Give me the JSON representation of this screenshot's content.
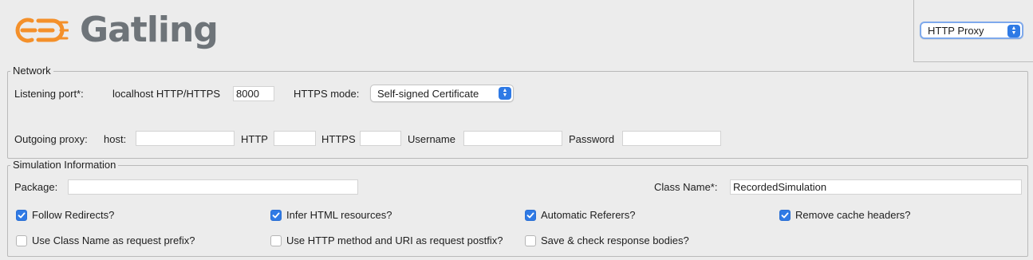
{
  "app": {
    "name": "Gatling"
  },
  "mode": {
    "selected": "HTTP Proxy"
  },
  "network": {
    "legend": "Network",
    "listening_port_label": "Listening port*:",
    "localhost_label": "localhost HTTP/HTTPS",
    "port_value": "8000",
    "https_mode_label": "HTTPS mode:",
    "https_mode_value": "Self-signed Certificate",
    "outgoing_proxy_label": "Outgoing proxy:",
    "host_label": "host:",
    "host_value": "",
    "http_label": "HTTP",
    "http_value": "",
    "https_label": "HTTPS",
    "https_value": "",
    "username_label": "Username",
    "username_value": "",
    "password_label": "Password",
    "password_value": ""
  },
  "simulation": {
    "legend": "Simulation Information",
    "package_label": "Package:",
    "package_value": "",
    "class_name_label": "Class Name*:",
    "class_name_value": "RecordedSimulation",
    "options": [
      {
        "label": "Follow Redirects?",
        "checked": true
      },
      {
        "label": "Infer HTML resources?",
        "checked": true
      },
      {
        "label": "Automatic Referers?",
        "checked": true
      },
      {
        "label": "Remove cache headers?",
        "checked": true
      },
      {
        "label": "Use Class Name as request prefix?",
        "checked": false
      },
      {
        "label": "Use HTTP method and URI as request postfix?",
        "checked": false
      },
      {
        "label": "Save & check response bodies?",
        "checked": false
      }
    ]
  },
  "colors": {
    "accent": "#2f7ae5",
    "logo_orange": "#f4902a",
    "logo_gray": "#6e7479"
  },
  "icons": {
    "logo": "gatling-logo-icon",
    "check": "checkmark-icon",
    "select": "select-arrows-icon"
  }
}
